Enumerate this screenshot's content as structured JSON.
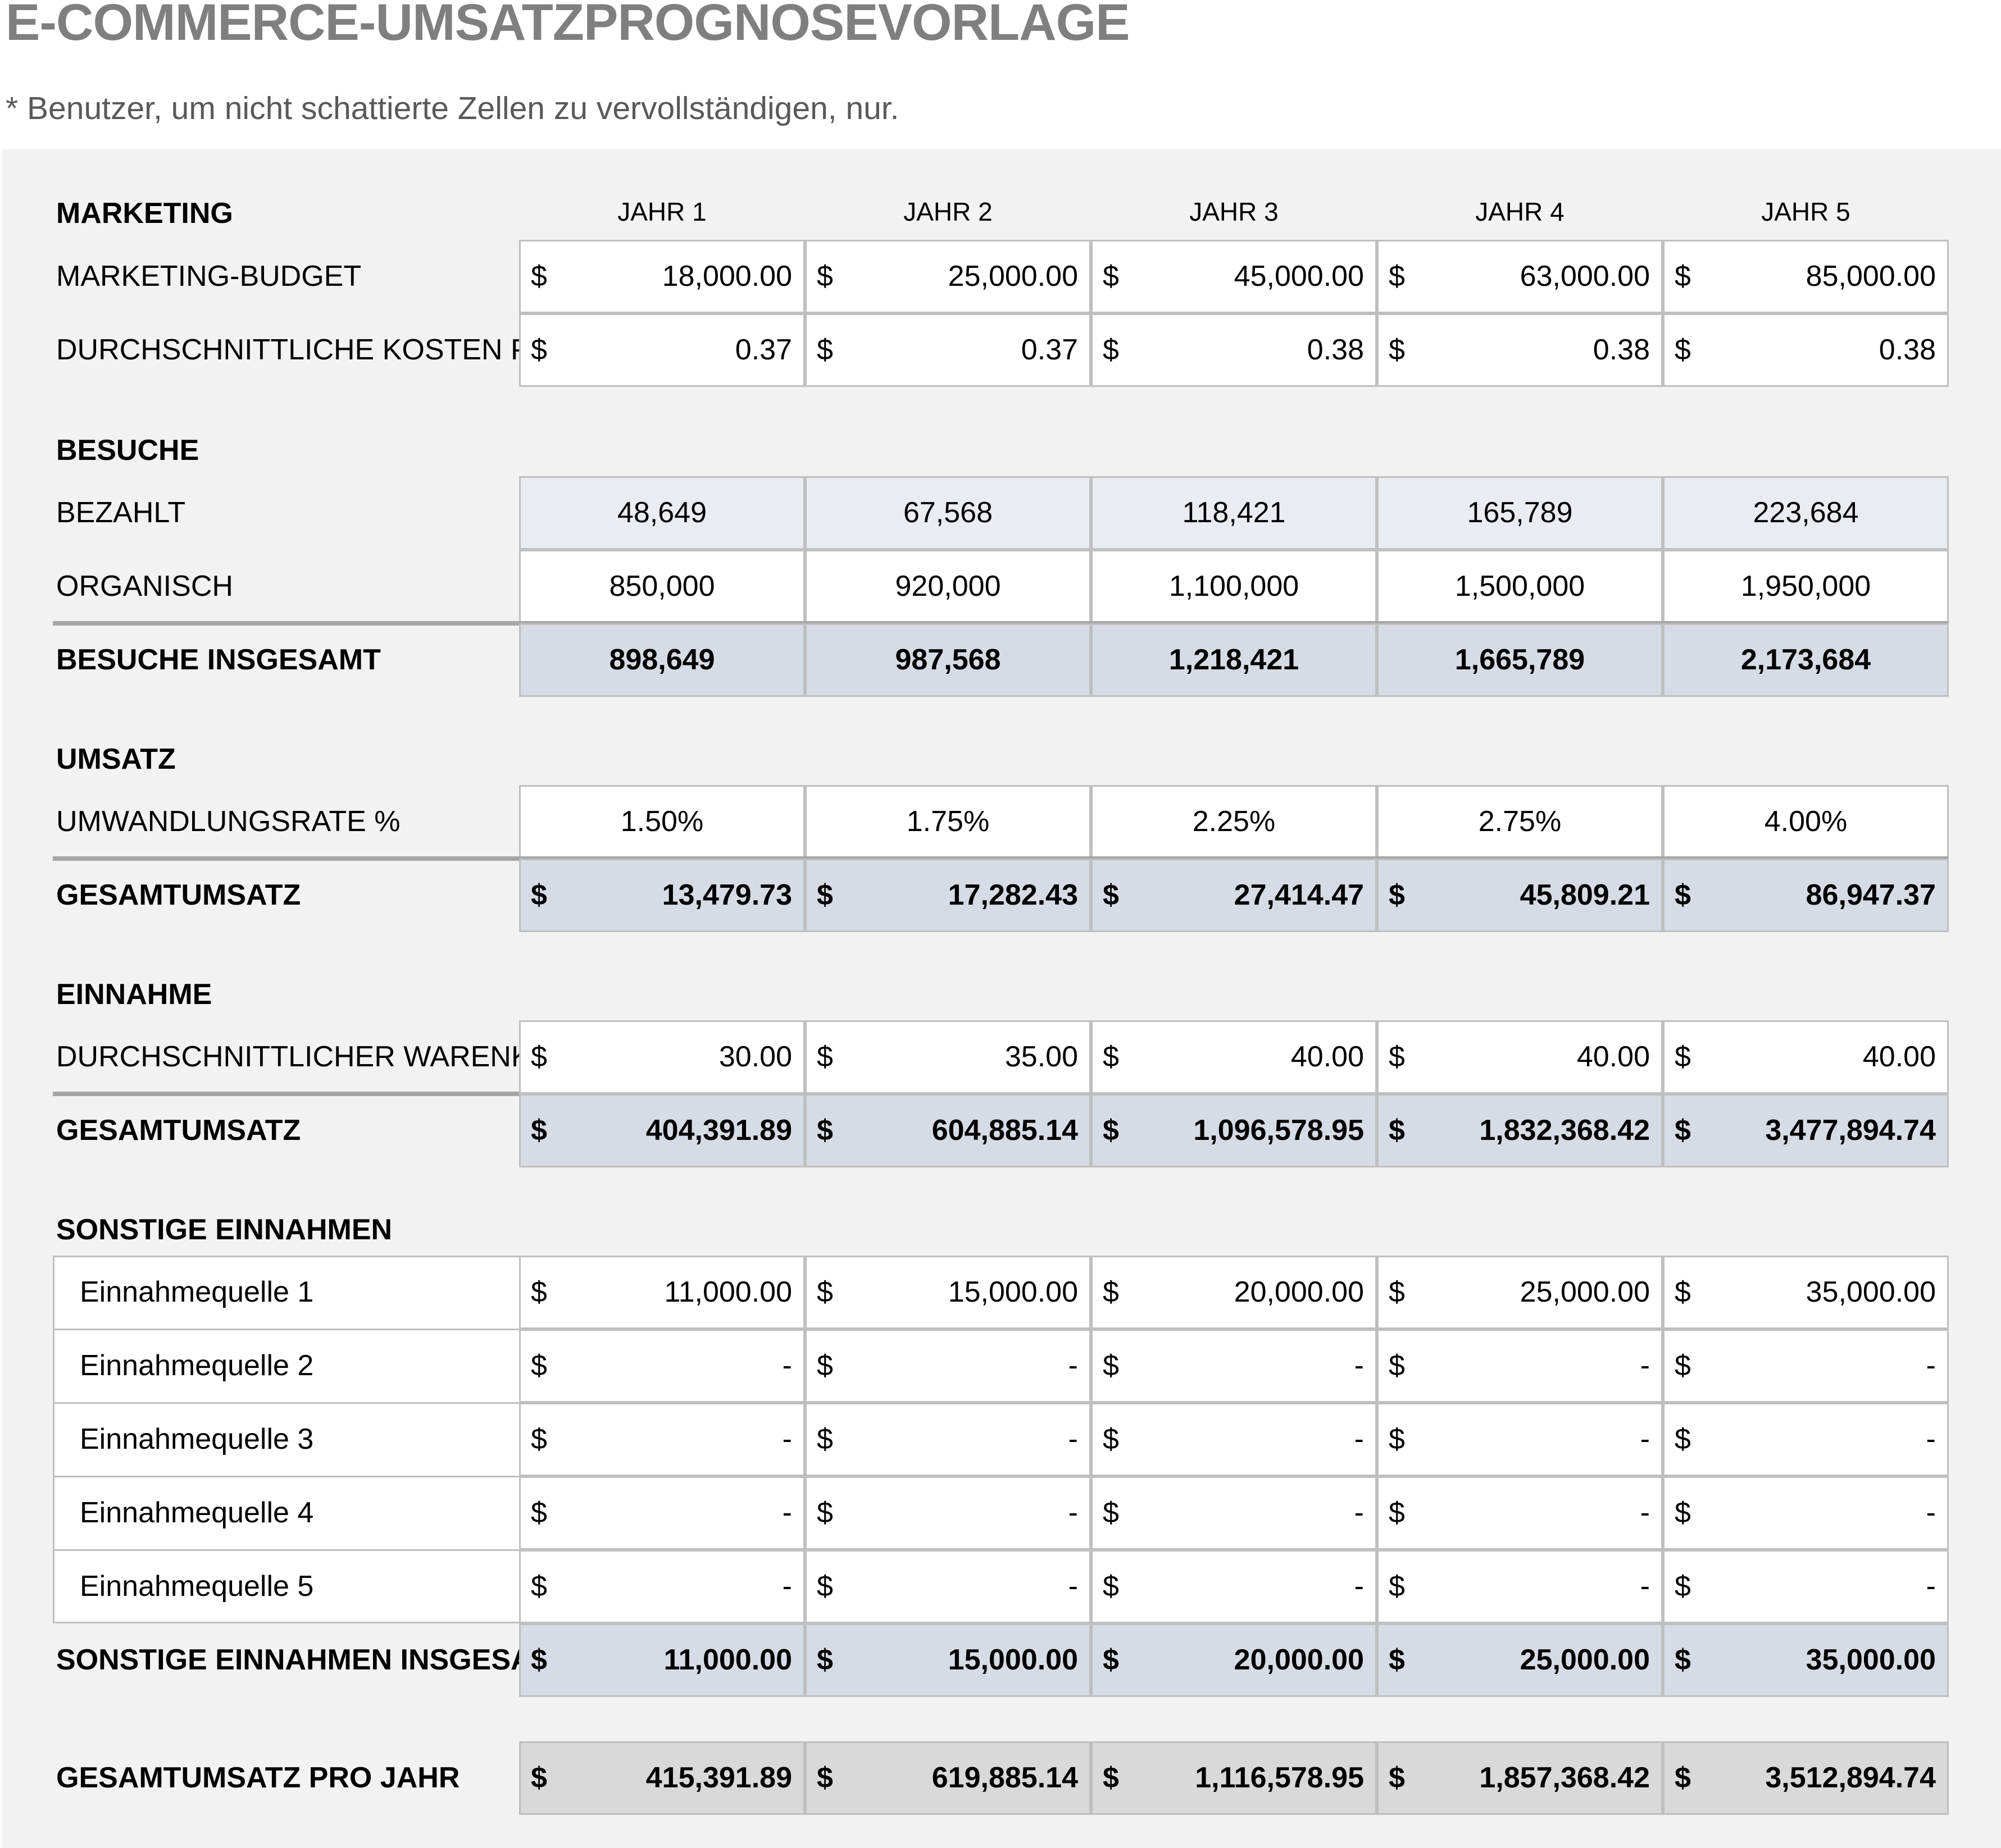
{
  "title": "E-COMMERCE-UMSATZPROGNOSEVORLAGE",
  "note": "* Benutzer, um nicht schattierte Zellen zu vervollständigen, nur.",
  "years": [
    "JAHR 1",
    "JAHR 2",
    "JAHR 3",
    "JAHR 4",
    "JAHR 5"
  ],
  "currency": "$",
  "sections": {
    "marketing": "MARKETING",
    "visits": "BESUCHE",
    "sales": "UMSATZ",
    "income": "EINNAHME",
    "other": "SONSTIGE EINNAHMEN"
  },
  "rows": {
    "marketing_budget": {
      "label": "MARKETING-BUDGET",
      "values": [
        "18,000.00",
        "25,000.00",
        "45,000.00",
        "63,000.00",
        "85,000.00"
      ]
    },
    "avg_cost": {
      "label": "DURCHSCHNITTLICHE KOSTEN PRO KLICK",
      "values": [
        "0.37",
        "0.37",
        "0.38",
        "0.38",
        "0.38"
      ]
    },
    "paid": {
      "label": "BEZAHLT",
      "values": [
        "48,649",
        "67,568",
        "118,421",
        "165,789",
        "223,684"
      ]
    },
    "organic": {
      "label": "ORGANISCH",
      "values": [
        "850,000",
        "920,000",
        "1,100,000",
        "1,500,000",
        "1,950,000"
      ]
    },
    "visits_total": {
      "label": "BESUCHE INSGESAMT",
      "values": [
        "898,649",
        "987,568",
        "1,218,421",
        "1,665,789",
        "2,173,684"
      ]
    },
    "conversion": {
      "label": "UMWANDLUNGSRATE %",
      "values": [
        "1.50%",
        "1.75%",
        "2.25%",
        "2.75%",
        "4.00%"
      ]
    },
    "sales_total": {
      "label": "GESAMTUMSATZ",
      "values": [
        "13,479.73",
        "17,282.43",
        "27,414.47",
        "45,809.21",
        "86,947.37"
      ]
    },
    "avg_cart": {
      "label": "DURCHSCHNITTLICHER WARENKORB",
      "values": [
        "30.00",
        "35.00",
        "40.00",
        "40.00",
        "40.00"
      ]
    },
    "revenue_total": {
      "label": "GESAMTUMSATZ",
      "values": [
        "404,391.89",
        "604,885.14",
        "1,096,578.95",
        "1,832,368.42",
        "3,477,894.74"
      ]
    },
    "source1": {
      "label": "Einnahmequelle 1",
      "values": [
        "11,000.00",
        "15,000.00",
        "20,000.00",
        "25,000.00",
        "35,000.00"
      ]
    },
    "source2": {
      "label": "Einnahmequelle 2",
      "values": [
        "-",
        "-",
        "-",
        "-",
        "-"
      ]
    },
    "source3": {
      "label": "Einnahmequelle 3",
      "values": [
        "-",
        "-",
        "-",
        "-",
        "-"
      ]
    },
    "source4": {
      "label": "Einnahmequelle 4",
      "values": [
        "-",
        "-",
        "-",
        "-",
        "-"
      ]
    },
    "source5": {
      "label": "Einnahmequelle 5",
      "values": [
        "-",
        "-",
        "-",
        "-",
        "-"
      ]
    },
    "other_total": {
      "label": "SONSTIGE EINNAHMEN INSGESAMT",
      "values": [
        "11,000.00",
        "15,000.00",
        "20,000.00",
        "25,000.00",
        "35,000.00"
      ]
    },
    "annual_total": {
      "label": "GESAMTUMSATZ PRO JAHR",
      "values": [
        "415,391.89",
        "619,885.14",
        "1,116,578.95",
        "1,857,368.42",
        "3,512,894.74"
      ]
    }
  },
  "colors": {
    "title": "#7f7f7f",
    "panel": "#f2f2f2",
    "input_cell": "#ffffff",
    "calc_light": "#e9ecf1",
    "calc_dark": "#d6dce5",
    "grand_total": "#d9d9d9",
    "border": "#bfbfbf"
  }
}
